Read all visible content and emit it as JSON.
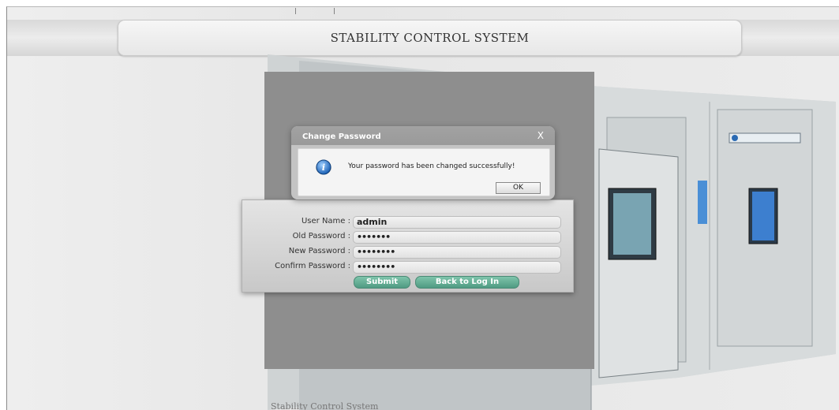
{
  "header": {
    "title": "STABILITY CONTROL SYSTEM"
  },
  "dialog": {
    "title": "Change Password",
    "close_glyph": "X",
    "message": "Your password has been changed successfully!",
    "ok_label": "OK",
    "icon": "info-icon"
  },
  "form": {
    "username_label": "User Name :",
    "username_value": "admin",
    "old_password_label": "Old Password :",
    "old_password_value": "•••••••",
    "new_password_label": "New Password :",
    "new_password_value": "••••••••",
    "confirm_password_label": "Confirm Password :",
    "confirm_password_value": "••••••••",
    "submit_label": "Submit",
    "back_label": "Back to Log In"
  },
  "footer": {
    "text": "Stability Control System"
  },
  "colors": {
    "button": "#5ea88f",
    "panel": "#8e8e8e"
  }
}
